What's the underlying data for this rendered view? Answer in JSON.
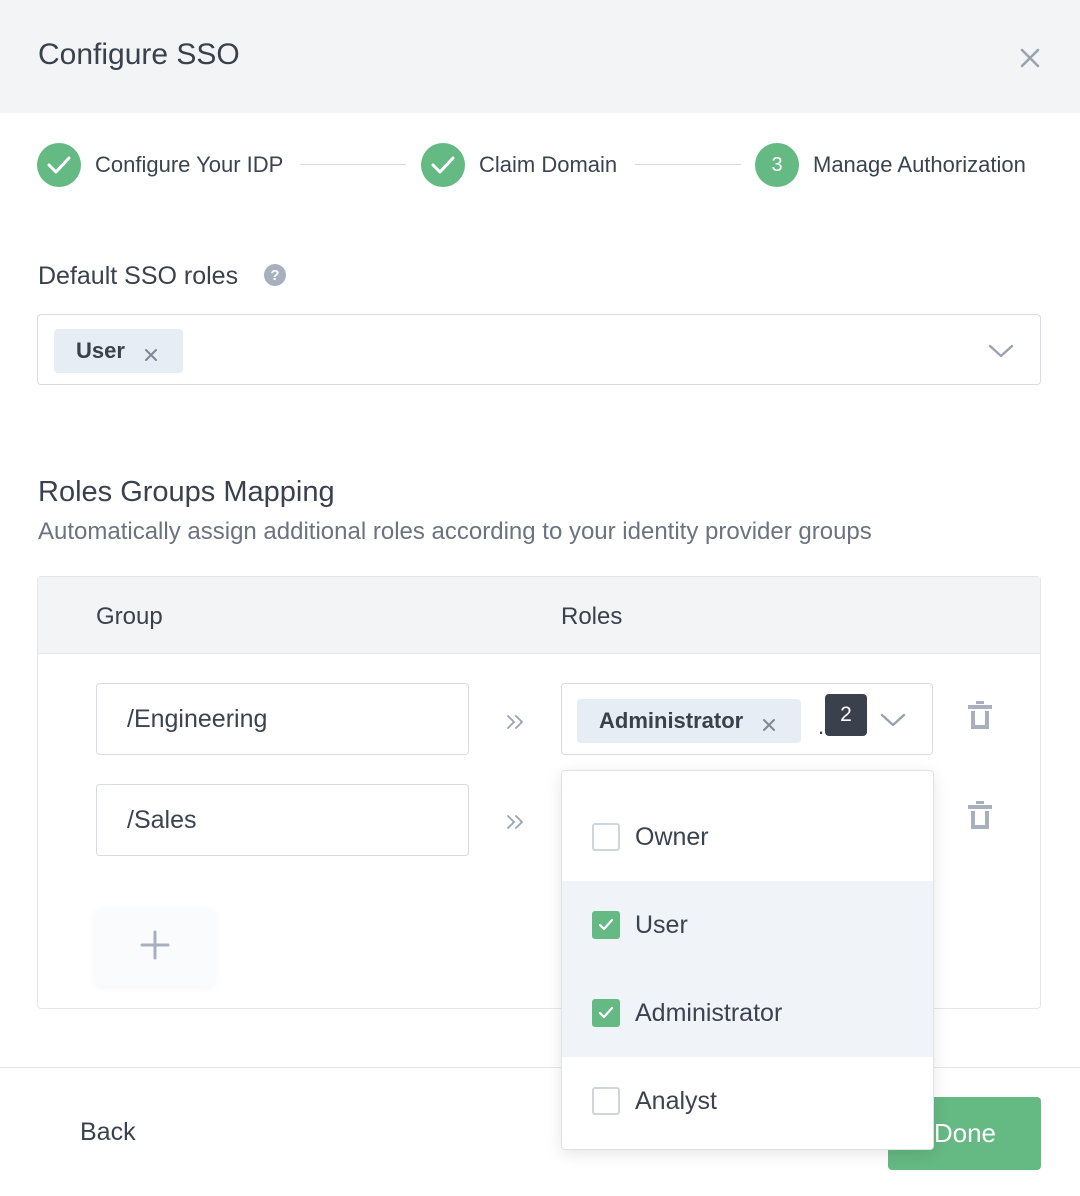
{
  "modal": {
    "title": "Configure SSO",
    "close_icon": "close-icon"
  },
  "stepper": {
    "steps": [
      {
        "label": "Configure Your IDP",
        "state": "complete"
      },
      {
        "label": "Claim Domain",
        "state": "complete"
      },
      {
        "label": "Manage Authorization",
        "state": "current",
        "number": "3"
      }
    ]
  },
  "default_roles": {
    "label": "Default SSO roles",
    "help_icon": "?",
    "selected": [
      "User"
    ]
  },
  "mapping": {
    "title": "Roles Groups Mapping",
    "subtitle": "Automatically assign additional roles according to your identity provider groups",
    "columns": {
      "group": "Group",
      "roles": "Roles"
    },
    "rows": [
      {
        "group": "/Engineering",
        "role_chip": "Administrator",
        "dot": ".",
        "more_count": "2"
      },
      {
        "group": "/Sales"
      }
    ]
  },
  "dropdown": {
    "options": [
      {
        "label": "Owner",
        "checked": false
      },
      {
        "label": "User",
        "checked": true
      },
      {
        "label": "Administrator",
        "checked": true
      },
      {
        "label": "Analyst",
        "checked": false
      }
    ]
  },
  "footer": {
    "back_label": "Back",
    "done_label": "Done"
  },
  "colors": {
    "accent": "#65b982",
    "header_bg": "#f3f4f6",
    "chip_bg": "#e6edf5",
    "text": "#3a414d"
  }
}
